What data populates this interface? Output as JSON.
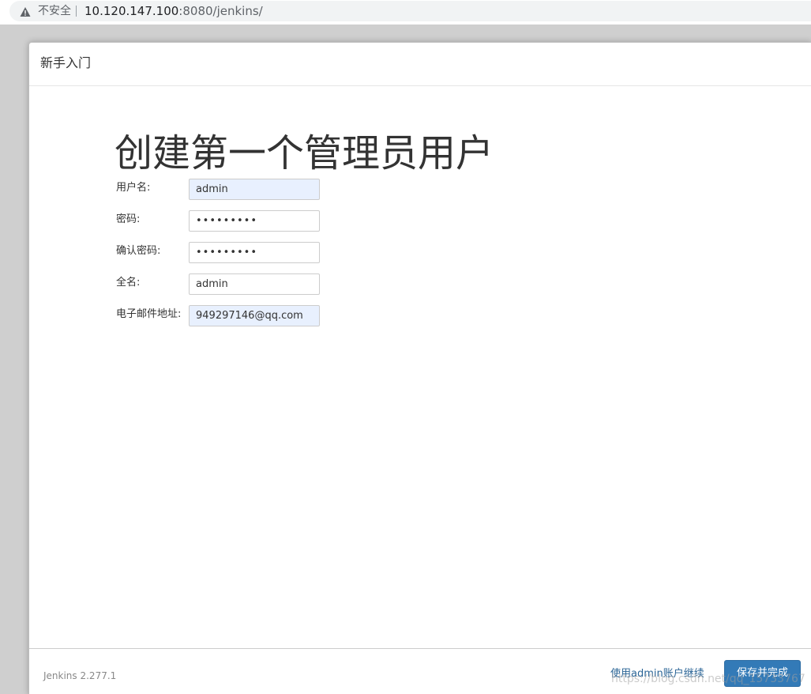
{
  "browser": {
    "security_label": "不安全",
    "url_host": "10.120.147.100",
    "url_rest": ":8080/jenkins/"
  },
  "dialog": {
    "title": "新手入门",
    "heading": "创建第一个管理员用户"
  },
  "form": {
    "fields": [
      {
        "label": "用户名:",
        "value": "admin",
        "autofilled": true
      },
      {
        "label": "密码:",
        "value": "•••••••••",
        "autofilled": false
      },
      {
        "label": "确认密码:",
        "value": "•••••••••",
        "autofilled": false
      },
      {
        "label": "全名:",
        "value": "admin",
        "autofilled": false
      },
      {
        "label": "电子邮件地址:",
        "value": "949297146@qq.com",
        "autofilled": true
      }
    ]
  },
  "footer": {
    "version": "Jenkins 2.277.1",
    "continue_link": "使用admin账户继续",
    "save_button": "保存并完成",
    "watermark": "https://blog.csdn.net/qq_15733767"
  },
  "icons": {
    "security": "warning-triangle-icon"
  },
  "colors": {
    "primary_button": "#337ab7",
    "link": "#2a6496",
    "autofill_bg": "#e8f0fe"
  }
}
